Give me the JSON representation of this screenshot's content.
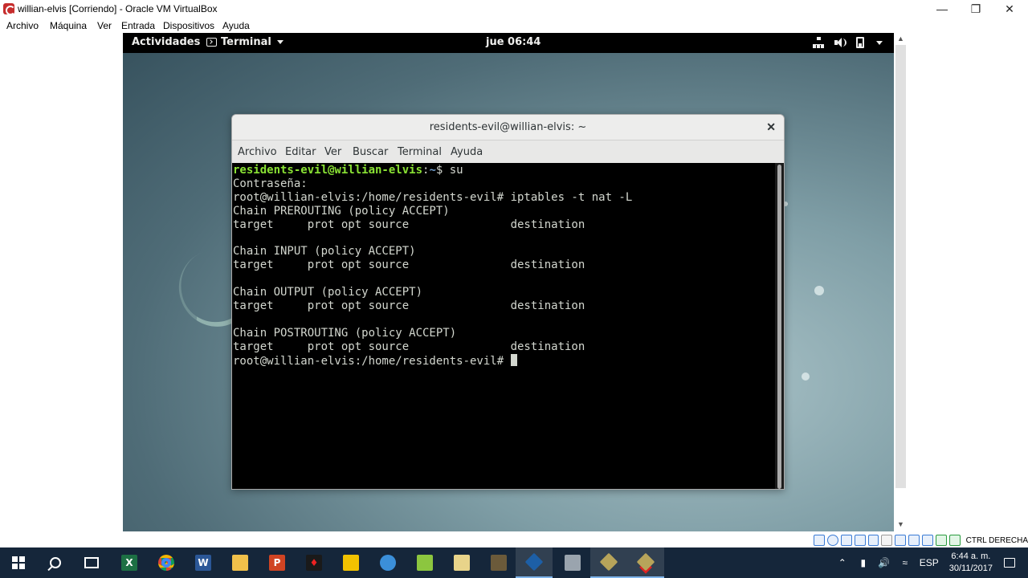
{
  "host_window": {
    "title": "willian-elvis [Corriendo] - Oracle VM VirtualBox",
    "menu": [
      "Archivo",
      "Máquina",
      "Ver",
      "Entrada",
      "Dispositivos",
      "Ayuda"
    ]
  },
  "gnome": {
    "activities": "Actividades",
    "app_menu": "Terminal",
    "clock": "jue 06:44"
  },
  "terminal": {
    "title": "residents-evil@willian-elvis: ~",
    "menu": [
      "Archivo",
      "Editar",
      "Ver",
      "Buscar",
      "Terminal",
      "Ayuda"
    ],
    "prompt_user": "residents-evil@willian-elvis",
    "prompt_sep": ":",
    "prompt_path": "~",
    "prompt_symbol": "$ ",
    "first_command": "su",
    "lines": [
      "Contraseña:",
      "root@willian-elvis:/home/residents-evil# iptables -t nat -L",
      "Chain PREROUTING (policy ACCEPT)",
      "target     prot opt source               destination",
      "",
      "Chain INPUT (policy ACCEPT)",
      "target     prot opt source               destination",
      "",
      "Chain OUTPUT (policy ACCEPT)",
      "target     prot opt source               destination",
      "",
      "Chain POSTROUTING (policy ACCEPT)",
      "target     prot opt source               destination"
    ],
    "current_prompt": "root@willian-elvis:/home/residents-evil# "
  },
  "status_bar": {
    "host_key": "CTRL DERECHA"
  },
  "taskbar": {
    "apps": [
      "start-icon",
      "search-icon",
      "task-view-icon",
      "excel-icon",
      "chrome-icon",
      "word-icon",
      "file-explorer-icon",
      "powerpoint-icon",
      "app-icon-red",
      "app-icon-yellow",
      "app-icon-blue",
      "notepad-icon",
      "folder-icon",
      "box-icon",
      "virtualbox-icon",
      "network-app-icon",
      "vm-icon",
      "vm-running-icon"
    ],
    "input_lang": "ESP",
    "time": "6:44 a. m.",
    "date": "30/11/2017"
  },
  "colors": {
    "prompt_user": "#8ae234",
    "prompt_path": "#729fcf",
    "taskbar_bg": "#15263a"
  }
}
